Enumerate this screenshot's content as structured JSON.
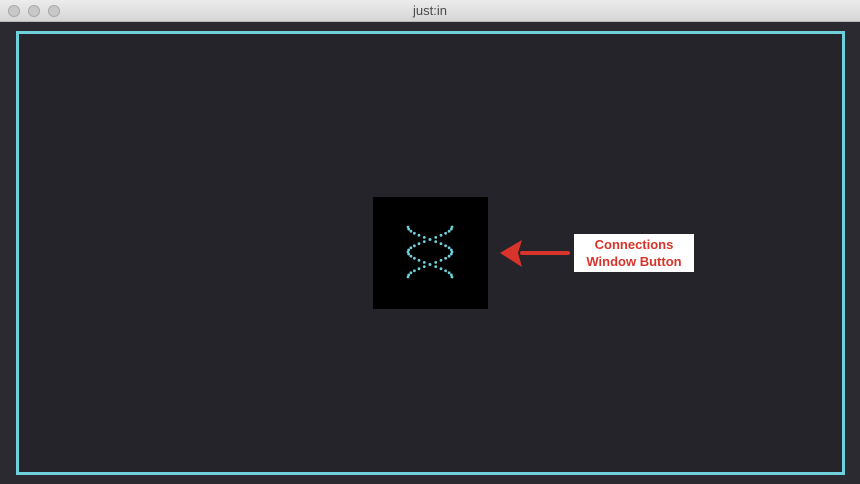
{
  "window": {
    "title": "just:in"
  },
  "connections_button": {
    "icon": "dna-helix-icon",
    "icon_color": "#6fd0dc"
  },
  "annotation": {
    "line1": "Connections",
    "line2": "Window Button",
    "color": "#d9342b"
  },
  "colors": {
    "canvas_border": "#6fd0dc",
    "canvas_background": "#24242a"
  }
}
